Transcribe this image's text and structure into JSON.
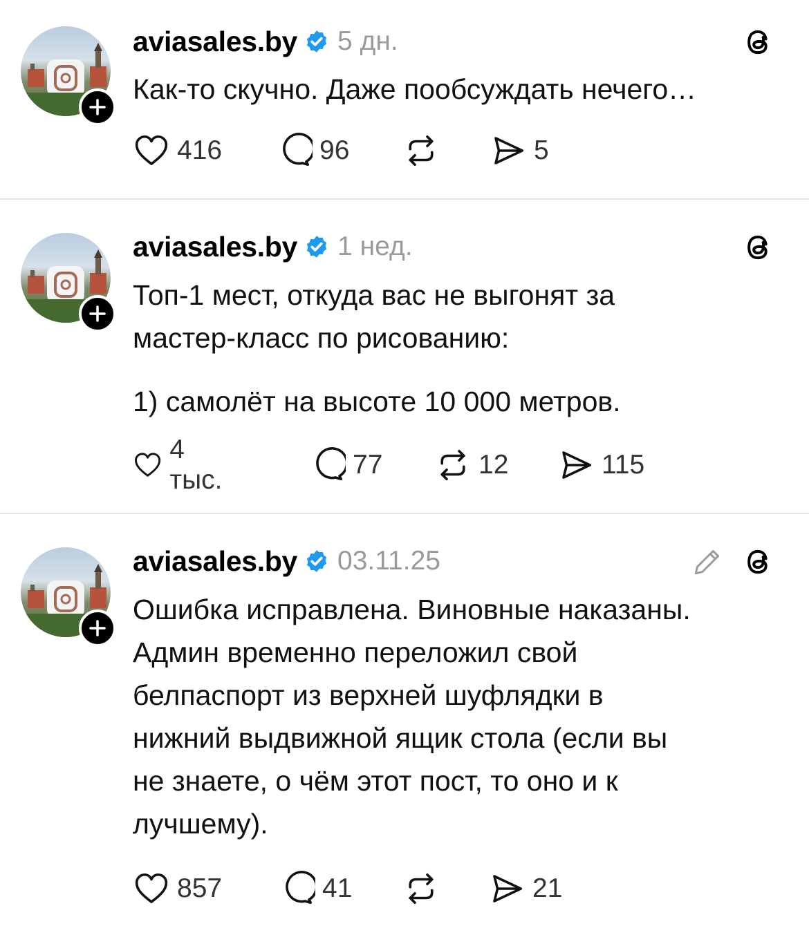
{
  "colors": {
    "verified": "#1d9bf0",
    "muted": "#9a9a9a",
    "divider": "#e3e3e3"
  },
  "posts": [
    {
      "username": "aviasales.by",
      "time": "5 дн.",
      "lines": [
        "Как-то скучно. Даже пообсуждать нечего…"
      ],
      "likes": "416",
      "replies": "96",
      "reposts": "",
      "shares": "5"
    },
    {
      "username": "aviasales.by",
      "time": "1 нед.",
      "lines": [
        "Топ-1 мест, откуда вас не выгонят за",
        "мастер-класс по рисованию:",
        "",
        "1) самолёт на высоте 10 000 метров."
      ],
      "likes": "4 тыс.",
      "replies": "77",
      "reposts": "12",
      "shares": "115"
    },
    {
      "username": "aviasales.by",
      "time": "03.11.25",
      "lines": [
        "Ошибка исправлена. Виновные наказаны.",
        "Админ временно переложил свой",
        "белпаспорт из верхней шуфлядки в",
        "нижний выдвижной ящик стола (если вы",
        "не знаете, о чём этот пост, то оно и к",
        "лучшему)."
      ],
      "likes": "857",
      "replies": "41",
      "reposts": "",
      "shares": "21"
    }
  ]
}
